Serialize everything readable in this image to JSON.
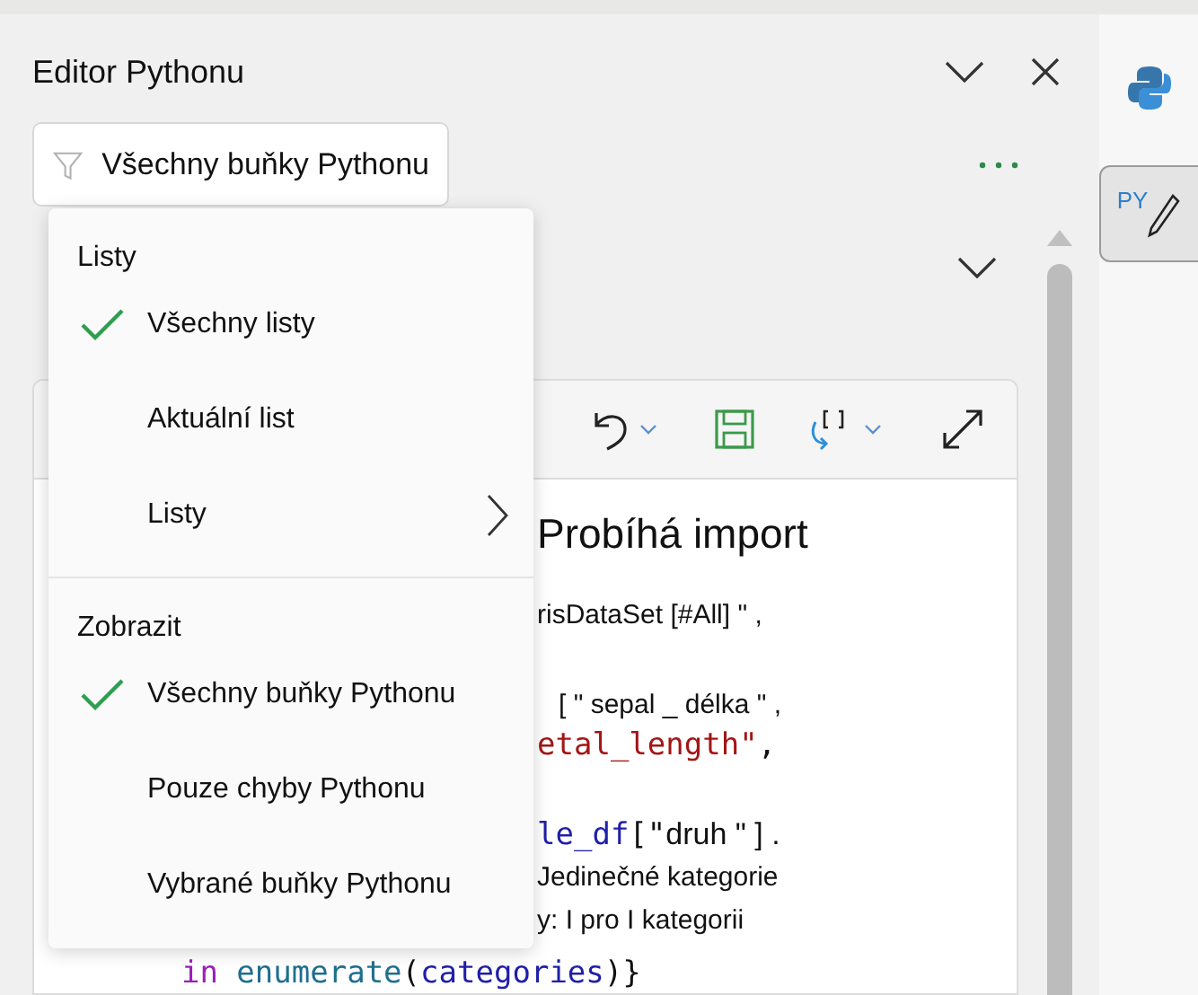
{
  "pane": {
    "title": "Editor Pythonu",
    "filter": {
      "label": "Všechny buňky Pythonu"
    }
  },
  "menu": {
    "sections": [
      {
        "heading": "Listy",
        "items": [
          {
            "label": "Všechny listy",
            "selected": true,
            "submenu": false
          },
          {
            "label": "Aktuální list",
            "selected": false,
            "submenu": false
          },
          {
            "label": "Listy",
            "selected": false,
            "submenu": true
          }
        ]
      },
      {
        "heading": "Zobrazit",
        "items": [
          {
            "label": "Všechny buňky Pythonu",
            "selected": true,
            "submenu": false
          },
          {
            "label": "Pouze chyby Pythonu",
            "selected": false,
            "submenu": false
          },
          {
            "label": "Vybrané buňky Pythonu",
            "selected": false,
            "submenu": false
          }
        ]
      }
    ]
  },
  "editor": {
    "lines": [
      {
        "kind": "heading",
        "parts": [
          {
            "kind": "plain",
            "text": "Probíhá import"
          }
        ]
      },
      {
        "kind": "text",
        "parts": [
          {
            "kind": "plain",
            "text": "risDataSet [#All] \" ,"
          }
        ]
      },
      {
        "kind": "text",
        "parts": [
          {
            "kind": "plain",
            "text": "[ \" sepal _ délka \" ,"
          }
        ]
      },
      {
        "kind": "code",
        "parts": [
          {
            "kind": "string",
            "text": "etal_length\""
          },
          {
            "kind": "punct",
            "text": ","
          }
        ]
      },
      {
        "kind": "code",
        "parts": [
          {
            "kind": "name",
            "text": "le_df"
          },
          {
            "kind": "punct",
            "text": "[\""
          },
          {
            "kind": "plain",
            "text": "druh \" ] ."
          }
        ]
      },
      {
        "kind": "text",
        "parts": [
          {
            "kind": "plain",
            "text": "Jedinečné kategorie"
          }
        ]
      },
      {
        "kind": "text",
        "parts": [
          {
            "kind": "plain",
            "text": "y: I pro I kategorii"
          }
        ]
      },
      {
        "kind": "code",
        "parts": [
          {
            "kind": "keyword",
            "text": "in"
          },
          {
            "kind": "func",
            "text": "enumerate"
          },
          {
            "kind": "punct",
            "text": "("
          },
          {
            "kind": "name",
            "text": "categories"
          },
          {
            "kind": "punct",
            "text": ")}"
          }
        ]
      }
    ]
  },
  "sidebar": {
    "items": [
      {
        "kind": "python",
        "selected": false
      },
      {
        "kind": "py-edit",
        "label": "PY",
        "selected": true
      }
    ]
  }
}
